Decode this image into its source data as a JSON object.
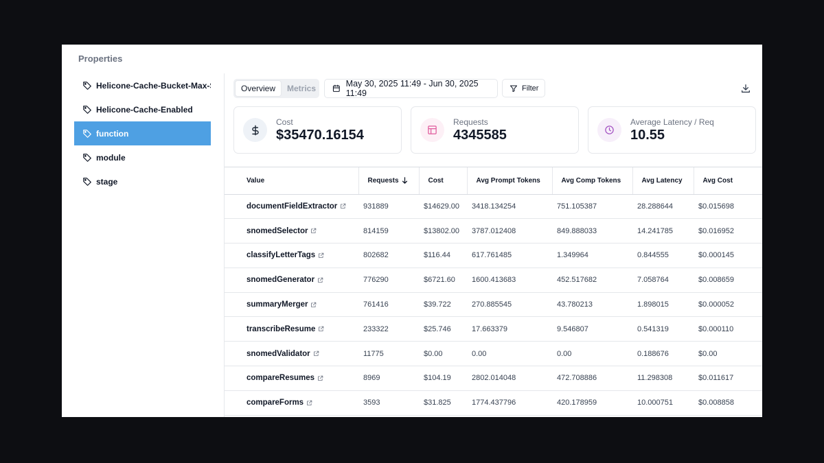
{
  "properties": {
    "title": "Properties",
    "items": [
      {
        "label": "Helicone-Cache-Bucket-Max-S",
        "active": false
      },
      {
        "label": "Helicone-Cache-Enabled",
        "active": false
      },
      {
        "label": "function",
        "active": true
      },
      {
        "label": "module",
        "active": false
      },
      {
        "label": "stage",
        "active": false
      }
    ]
  },
  "toolbar": {
    "tab_overview": "Overview",
    "tab_metrics": "Metrics",
    "date_range": "May 30, 2025 11:49 - Jun 30, 2025 11:49",
    "filter_label": "Filter"
  },
  "cards": [
    {
      "label": "Cost",
      "value": "$35470.16154",
      "icon": "dollar-icon",
      "icon_bg": "#eef2f7"
    },
    {
      "label": "Requests",
      "value": "4345585",
      "icon": "table-icon",
      "icon_bg": "#fdf0f6"
    },
    {
      "label": "Average Latency / Req",
      "value": "10.55",
      "icon": "clock-icon",
      "icon_bg": "#f7effa"
    }
  ],
  "table": {
    "headers": [
      "Value",
      "Requests",
      "Cost",
      "Avg Prompt Tokens",
      "Avg Comp Tokens",
      "Avg Latency",
      "Avg Cost"
    ],
    "rows": [
      [
        "documentFieldExtractor",
        "931889",
        "$14629.00",
        "3418.134254",
        "751.105387",
        "28.288644",
        "$0.015698"
      ],
      [
        "snomedSelector",
        "814159",
        "$13802.00",
        "3787.012408",
        "849.888033",
        "14.241785",
        "$0.016952"
      ],
      [
        "classifyLetterTags",
        "802682",
        "$116.44",
        "617.761485",
        "1.349964",
        "0.844555",
        "$0.000145"
      ],
      [
        "snomedGenerator",
        "776290",
        "$6721.60",
        "1600.413683",
        "452.517682",
        "7.058764",
        "$0.008659"
      ],
      [
        "summaryMerger",
        "761416",
        "$39.722",
        "270.885545",
        "43.780213",
        "1.898015",
        "$0.000052"
      ],
      [
        "transcribeResume",
        "233322",
        "$25.746",
        "17.663379",
        "9.546807",
        "0.541319",
        "$0.000110"
      ],
      [
        "snomedValidator",
        "11775",
        "$0.00",
        "0.00",
        "0.00",
        "0.188676",
        "$0.00"
      ],
      [
        "compareResumes",
        "8969",
        "$104.19",
        "2802.014048",
        "472.708886",
        "11.298308",
        "$0.011617"
      ],
      [
        "compareForms",
        "3593",
        "$31.825",
        "1774.437796",
        "420.178959",
        "10.000751",
        "$0.008858"
      ]
    ]
  },
  "colors": {
    "accent": "#4ea0e3",
    "dollar": "#1f2937",
    "requests": "#e05a9c",
    "latency": "#a352c2"
  }
}
